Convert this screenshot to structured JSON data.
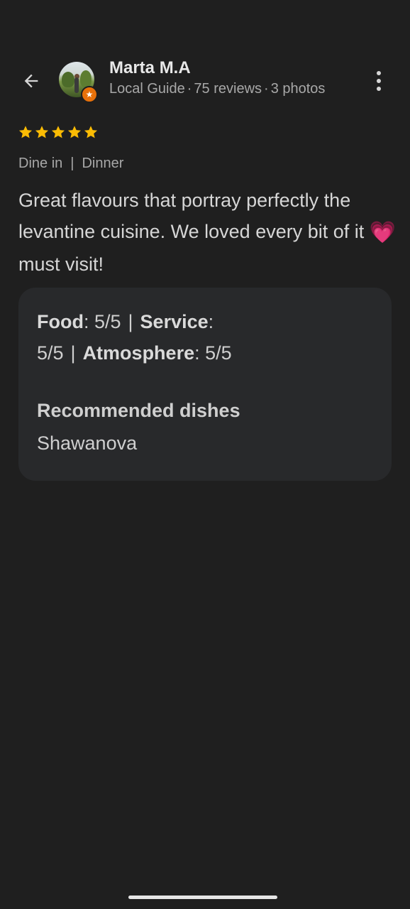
{
  "reviewer": {
    "name": "Marta M.A",
    "level": "Local Guide",
    "reviews": "75 reviews",
    "photos": "3 photos",
    "separator": "·"
  },
  "rating": {
    "stars": 5,
    "star_color": "#fbbc04"
  },
  "tags": {
    "service": "Dine in",
    "meal": "Dinner",
    "separator": "|"
  },
  "review": {
    "text": "Great flavours that portray perfectly the levantine cuisine. We loved every bit of it",
    "emoji": "💗",
    "text_after_emoji": " must visit!"
  },
  "details": {
    "food_label": "Food",
    "food_value": ": 5/5",
    "service_label": "Service",
    "service_value": ":",
    "service_score": "5/5",
    "atmosphere_label": "Atmosphere",
    "atmosphere_value": ": 5/5",
    "separator": "|",
    "recommended_title": "Recommended dishes",
    "recommended_value": "Shawanova"
  },
  "icons": {
    "back": "arrow-back-icon",
    "more": "more-vertical-icon",
    "badge": "local-guide-star-icon"
  },
  "colors": {
    "background": "#1f1f1f",
    "card": "#28292b",
    "badge": "#e8710a",
    "heart": "#e6458a"
  }
}
